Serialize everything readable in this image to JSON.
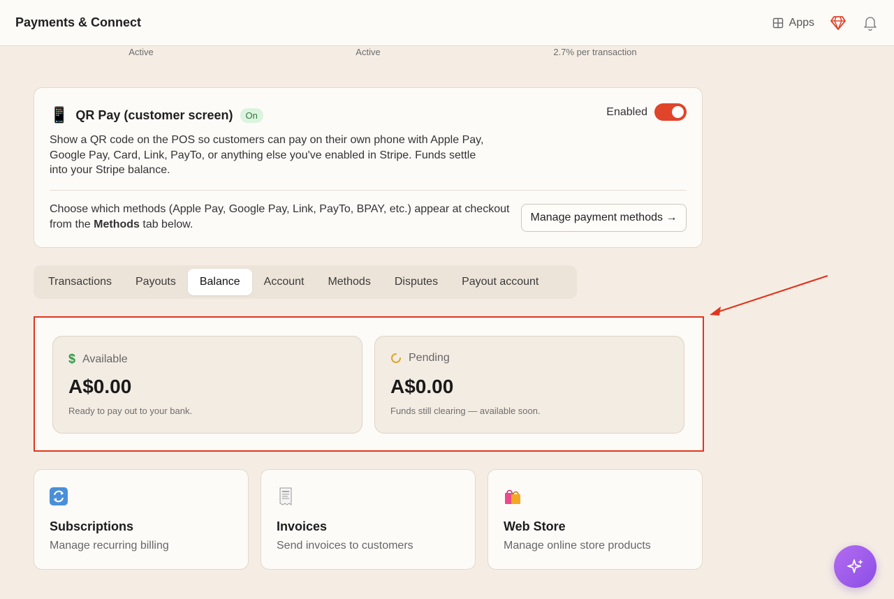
{
  "app": {
    "title": "Payments & Connect"
  },
  "topbar": {
    "apps_label": "Apps",
    "gem_icon": "gem-icon",
    "bell_icon": "bell-icon",
    "grid_icon": "grid-icon"
  },
  "status_row": [
    "Active",
    "Active",
    "2.7% per transaction"
  ],
  "qr_pay": {
    "icon": "📱",
    "title": "QR Pay (customer screen)",
    "badge": "On",
    "toggle_label": "Enabled",
    "toggle_on": true,
    "description": "Show a QR code on the POS so customers can pay on their own phone with Apple Pay, Google Pay, Card, Link, PayTo, or anything else you've enabled in Stripe. Funds settle into your Stripe balance.",
    "methods_note_pre": "Choose which methods (Apple Pay, Google Pay, Link, PayTo, BPAY, etc.) appear at checkout from the ",
    "methods_note_bold": "Methods",
    "methods_note_post": " tab below.",
    "manage_button": "Manage payment methods →"
  },
  "tabs": [
    {
      "label": "Transactions",
      "active": false
    },
    {
      "label": "Payouts",
      "active": false
    },
    {
      "label": "Balance",
      "active": true
    },
    {
      "label": "Account",
      "active": false
    },
    {
      "label": "Methods",
      "active": false
    },
    {
      "label": "Disputes",
      "active": false
    },
    {
      "label": "Payout account",
      "active": false
    }
  ],
  "balance": {
    "available": {
      "label": "Available",
      "amount": "A$0.00",
      "note": "Ready to pay out to your bank.",
      "icon": "dollar-icon"
    },
    "pending": {
      "label": "Pending",
      "amount": "A$0.00",
      "note": "Funds still clearing — available soon.",
      "icon": "spinner-icon"
    }
  },
  "features": [
    {
      "title": "Subscriptions",
      "subtitle": "Manage recurring billing",
      "icon": "🔄"
    },
    {
      "title": "Invoices",
      "subtitle": "Send invoices to customers",
      "icon": "🧾"
    },
    {
      "title": "Web Store",
      "subtitle": "Manage online store products",
      "icon": "🛍️"
    }
  ],
  "colors": {
    "accent": "#e0442a",
    "highlight": "#e0351e",
    "fab": "#9b5cf0",
    "bg": "#f5ede4"
  }
}
